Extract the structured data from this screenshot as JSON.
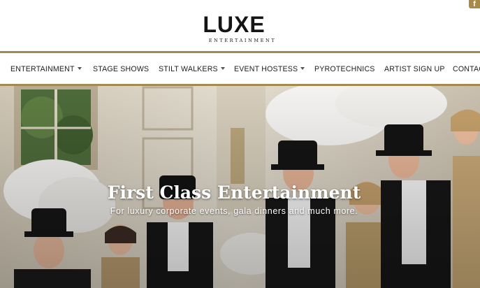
{
  "brand": {
    "name": "LUXE",
    "tagline": "ENTERTAINMENT"
  },
  "social": {
    "facebook_glyph": "f",
    "icon": "facebook-icon"
  },
  "nav": {
    "items": [
      {
        "label": "ENTERTAINMENT",
        "dropdown": true
      },
      {
        "label": "STAGE SHOWS",
        "dropdown": false
      },
      {
        "label": "STILT WALKERS",
        "dropdown": true
      },
      {
        "label": "EVENT HOSTESS",
        "dropdown": true
      },
      {
        "label": "PYROTECHNICS",
        "dropdown": false
      },
      {
        "label": "ARTIST SIGN UP",
        "dropdown": false
      },
      {
        "label": "CONTACT",
        "dropdown": false
      }
    ]
  },
  "hero": {
    "title": "First Class Entertainment",
    "subtitle": "For luxury corporate events, gala dinners and much more."
  },
  "colors": {
    "accent_gold": "#a38a4e",
    "text_dark": "#1d1d1d"
  }
}
